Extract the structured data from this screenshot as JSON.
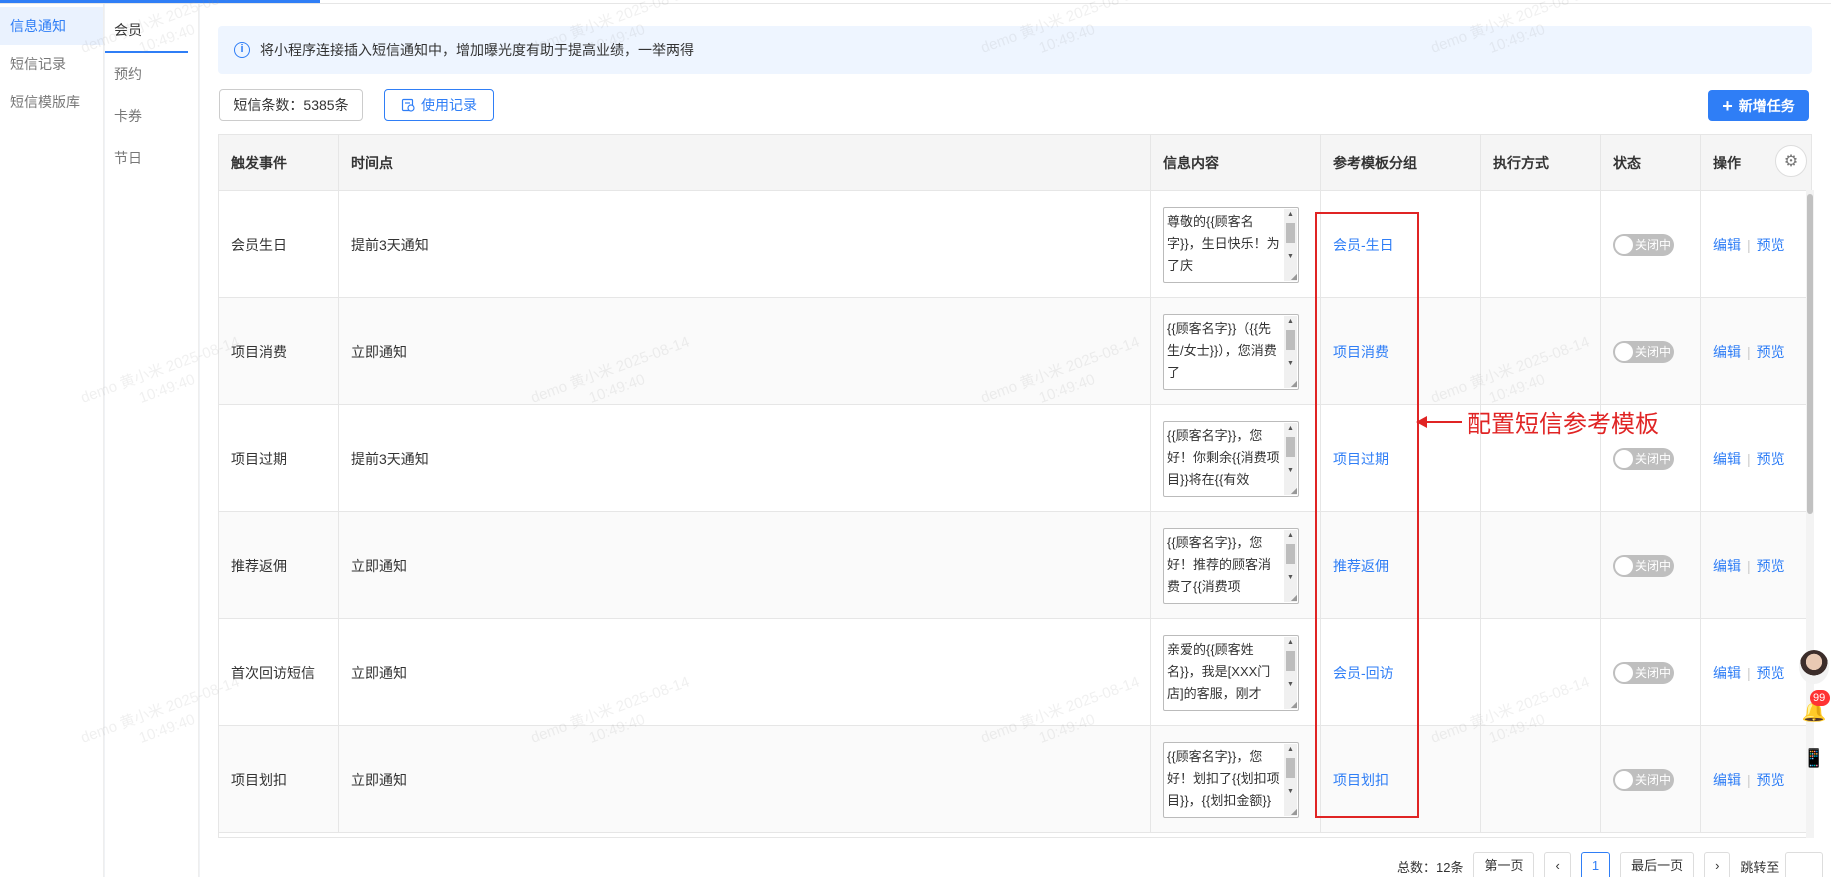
{
  "nav_primary": [
    {
      "label": "信息通知",
      "active": true
    },
    {
      "label": "短信记录",
      "active": false
    },
    {
      "label": "短信模版库",
      "active": false
    }
  ],
  "nav_secondary": [
    {
      "label": "会员",
      "active": true
    },
    {
      "label": "预约",
      "active": false
    },
    {
      "label": "卡券",
      "active": false
    },
    {
      "label": "节日",
      "active": false
    }
  ],
  "info_banner": "将小程序连接插入短信通知中，增加曝光度有助于提高业绩，一举两得",
  "sms_count": "短信条数：5385条",
  "use_record_label": "使用记录",
  "new_task_label": "新增任务",
  "table": {
    "columns": [
      "触发事件",
      "时间点",
      "信息内容",
      "参考模板分组",
      "执行方式",
      "状态",
      "操作"
    ],
    "rows": [
      {
        "event": "会员生日",
        "time": "提前3天通知",
        "content": "尊敬的{{顾客名字}}，生日快乐！为了庆",
        "group": "会员-生日",
        "status": "关闭中"
      },
      {
        "event": "项目消费",
        "time": "立即通知",
        "content": "{{顾客名字}}（{{先生/女士}}），您消费了",
        "group": "项目消费",
        "status": "关闭中"
      },
      {
        "event": "项目过期",
        "time": "提前3天通知",
        "content": "{{顾客名字}}，您好！你剩余{{消费项目}}将在{{有效",
        "group": "项目过期",
        "status": "关闭中"
      },
      {
        "event": "推荐返佣",
        "time": "立即通知",
        "content": "{{顾客名字}}，您好！推荐的顾客消费了{{消费项",
        "group": "推荐返佣",
        "status": "关闭中"
      },
      {
        "event": "首次回访短信",
        "time": "立即通知",
        "content": "亲爱的{{顾客姓名}}，我是[XXX门店]的客服，刚才",
        "group": "会员-回访",
        "status": "关闭中"
      },
      {
        "event": "项目划扣",
        "time": "立即通知",
        "content": "{{顾客名字}}，您好！划扣了{{划扣项目}}，{{划扣金额}}",
        "group": "项目划扣",
        "status": "关闭中"
      }
    ],
    "op_edit": "编辑",
    "op_preview": "预览"
  },
  "annotation": "配置短信参考模板",
  "pagination": {
    "total": "总数：12条",
    "first": "第一页",
    "current": "1",
    "last": "最后一页",
    "jump": "跳转至"
  },
  "notification_badge": "99",
  "watermark": {
    "line1": "demo 黄小米 2025-08-14",
    "line2": "10:49:40"
  },
  "colors": {
    "accent": "#2f7ef6",
    "annotation": "#e02424",
    "toggle_off": "#bfbfbf"
  }
}
